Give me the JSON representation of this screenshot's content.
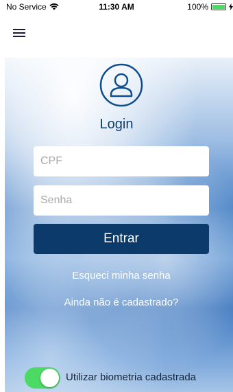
{
  "status_bar": {
    "carrier": "No Service",
    "time": "11:30 AM",
    "battery": "100%",
    "battery_level": 1.0,
    "icons": [
      "wifi-icon",
      "battery-icon",
      "charging-icon"
    ]
  },
  "nav": {
    "menu_icon": "hamburger-menu-icon"
  },
  "login": {
    "icon": "user-circle-icon",
    "title": "Login",
    "cpf_placeholder": "CPF",
    "cpf_value": "",
    "senha_placeholder": "Senha",
    "senha_value": "",
    "submit_label": "Entrar",
    "forgot_label": "Esqueci minha senha",
    "register_label": "Ainda não é cadastrado?"
  },
  "biometric": {
    "label": "Utilizar biometria cadastrada",
    "enabled": true
  },
  "colors": {
    "accent": "#0c3b6b",
    "title": "#0f3f6e",
    "toggle_on": "#4cd964"
  }
}
